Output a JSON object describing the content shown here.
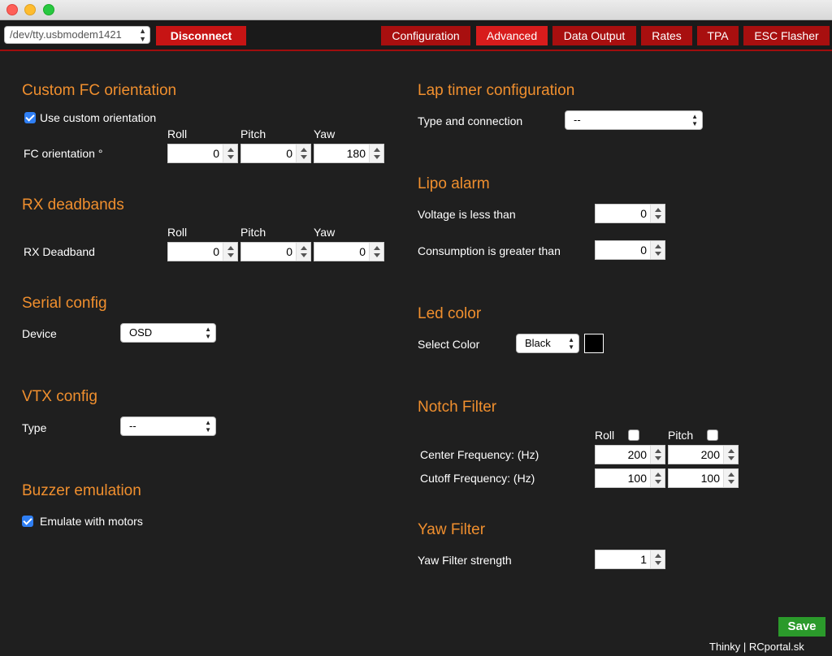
{
  "toolbar": {
    "port": "/dev/tty.usbmodem1421",
    "disconnect": "Disconnect",
    "tabs": [
      "Configuration",
      "Advanced",
      "Data Output",
      "Rates",
      "TPA",
      "ESC Flasher"
    ],
    "active_tab": "Advanced"
  },
  "fc_orientation": {
    "title": "Custom FC orientation",
    "use_custom_label": "Use custom orientation",
    "use_custom_checked": true,
    "cols": [
      "Roll",
      "Pitch",
      "Yaw"
    ],
    "row_label": "FC orientation °",
    "values": [
      "0",
      "0",
      "180"
    ]
  },
  "rx_deadbands": {
    "title": "RX deadbands",
    "cols": [
      "Roll",
      "Pitch",
      "Yaw"
    ],
    "row_label": "RX Deadband",
    "values": [
      "0",
      "0",
      "0"
    ]
  },
  "serial": {
    "title": "Serial config",
    "device_label": "Device",
    "device_value": "OSD"
  },
  "vtx": {
    "title": "VTX config",
    "type_label": "Type",
    "type_value": "--"
  },
  "buzzer": {
    "title": "Buzzer emulation",
    "emulate_label": "Emulate with motors",
    "emulate_checked": true
  },
  "lap_timer": {
    "title": "Lap timer configuration",
    "type_label": "Type and connection",
    "type_value": "--"
  },
  "lipo": {
    "title": "Lipo alarm",
    "voltage_label": "Voltage is less than",
    "voltage_value": "0",
    "consumption_label": "Consumption is greater than",
    "consumption_value": "0"
  },
  "led": {
    "title": "Led color",
    "select_label": "Select Color",
    "color_value": "Black",
    "swatch_color": "#000000"
  },
  "notch": {
    "title": "Notch Filter",
    "roll_label": "Roll",
    "pitch_label": "Pitch",
    "roll_checked": false,
    "pitch_checked": false,
    "center_label": "Center Frequency: (Hz)",
    "center_roll": "200",
    "center_pitch": "200",
    "cutoff_label": "Cutoff Frequency: (Hz)",
    "cutoff_roll": "100",
    "cutoff_pitch": "100"
  },
  "yaw_filter": {
    "title": "Yaw Filter",
    "strength_label": "Yaw Filter strength",
    "strength_value": "1"
  },
  "save_label": "Save",
  "footer": "Thinky | RCportal.sk",
  "colors": {
    "heading": "#f08f2e",
    "tab": "#a80f0f",
    "tab_active": "#d81c1c",
    "save": "#2b9a2b",
    "checkbox": "#2f7ff5"
  }
}
